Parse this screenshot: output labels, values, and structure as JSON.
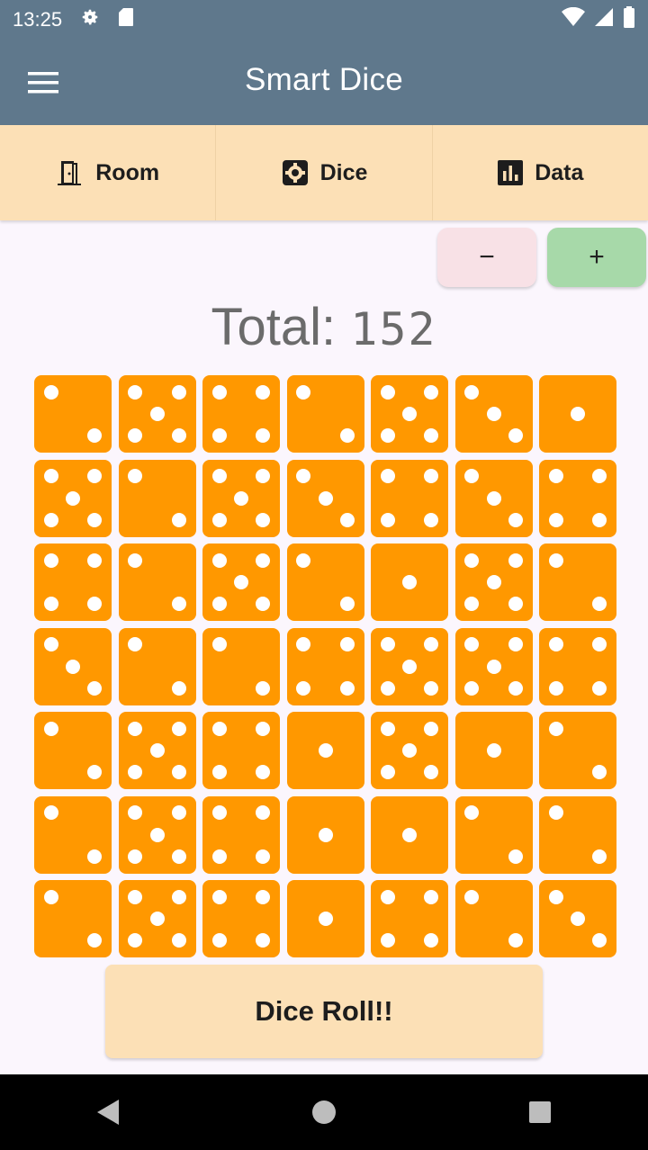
{
  "status_bar": {
    "time": "13:25",
    "icons_left": [
      "settings-icon",
      "sd-card-icon"
    ],
    "icons_right": [
      "wifi-icon",
      "signal-icon",
      "battery-icon"
    ]
  },
  "app_bar": {
    "title": "Smart Dice",
    "menu_icon": "menu-icon",
    "color": "#5f788c"
  },
  "tabs": [
    {
      "label": "Room",
      "icon": "door-icon"
    },
    {
      "label": "Dice",
      "icon": "dice-gear-icon"
    },
    {
      "label": "Data",
      "icon": "bar-chart-icon"
    }
  ],
  "stepper": {
    "minus_label": "−",
    "plus_label": "+"
  },
  "total": {
    "label": "Total: ",
    "value": "152"
  },
  "dice": [
    [
      2,
      5,
      4,
      2,
      5,
      3,
      1
    ],
    [
      5,
      2,
      5,
      3,
      4,
      3,
      4
    ],
    [
      4,
      2,
      5,
      2,
      1,
      5,
      2
    ],
    [
      3,
      2,
      2,
      4,
      5,
      5,
      4
    ],
    [
      2,
      5,
      4,
      1,
      5,
      1,
      2
    ],
    [
      2,
      5,
      4,
      1,
      1,
      2,
      2
    ],
    [
      2,
      5,
      4,
      1,
      4,
      2,
      3
    ]
  ],
  "roll_button": {
    "label": "Dice Roll!!"
  },
  "nav_bar": {
    "icons": [
      "back-icon",
      "home-icon",
      "recents-icon"
    ]
  },
  "colors": {
    "accent": "#5f788c",
    "die": "#ff9800",
    "tab_bg": "#fce0b6",
    "minus_bg": "#f8e1e6",
    "plus_bg": "#a7d9a9"
  }
}
